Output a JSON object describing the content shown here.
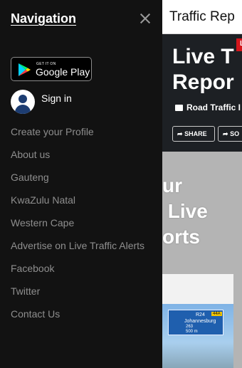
{
  "background_page": {
    "title": "Traffic Rep",
    "hero": {
      "badge": "LI",
      "headline": "Live T\nRepor",
      "sub": "Road Traffic I",
      "share_label": "SHARE",
      "so_label": "SO"
    },
    "section_text": "ur\n Live\norts",
    "image_sign": {
      "route": "R24",
      "ref": "44A",
      "city": "Johannesburg",
      "line3": "263",
      "line4": "500 m"
    }
  },
  "drawer": {
    "title": "Navigation",
    "google_play": {
      "small_text": "GET IT ON",
      "big_text": "Google Play"
    },
    "sign_in_label": "Sign in",
    "menu_items": [
      {
        "label": "Create your Profile"
      },
      {
        "label": "About us"
      },
      {
        "label": "Gauteng"
      },
      {
        "label": "KwaZulu Natal"
      },
      {
        "label": "Western Cape"
      },
      {
        "label": "Advertise on Live Traffic Alerts"
      },
      {
        "label": "Facebook"
      },
      {
        "label": "Twitter"
      },
      {
        "label": "Contact Us"
      }
    ]
  },
  "colors": {
    "drawer_bg": "#121212",
    "menu_text": "#8e8e8e",
    "badge_red": "#d4161c",
    "sign_blue": "#1f5fae"
  },
  "icons": [
    "close-icon",
    "google-play-icon",
    "user-avatar-icon",
    "camera-icon",
    "share-icon"
  ]
}
